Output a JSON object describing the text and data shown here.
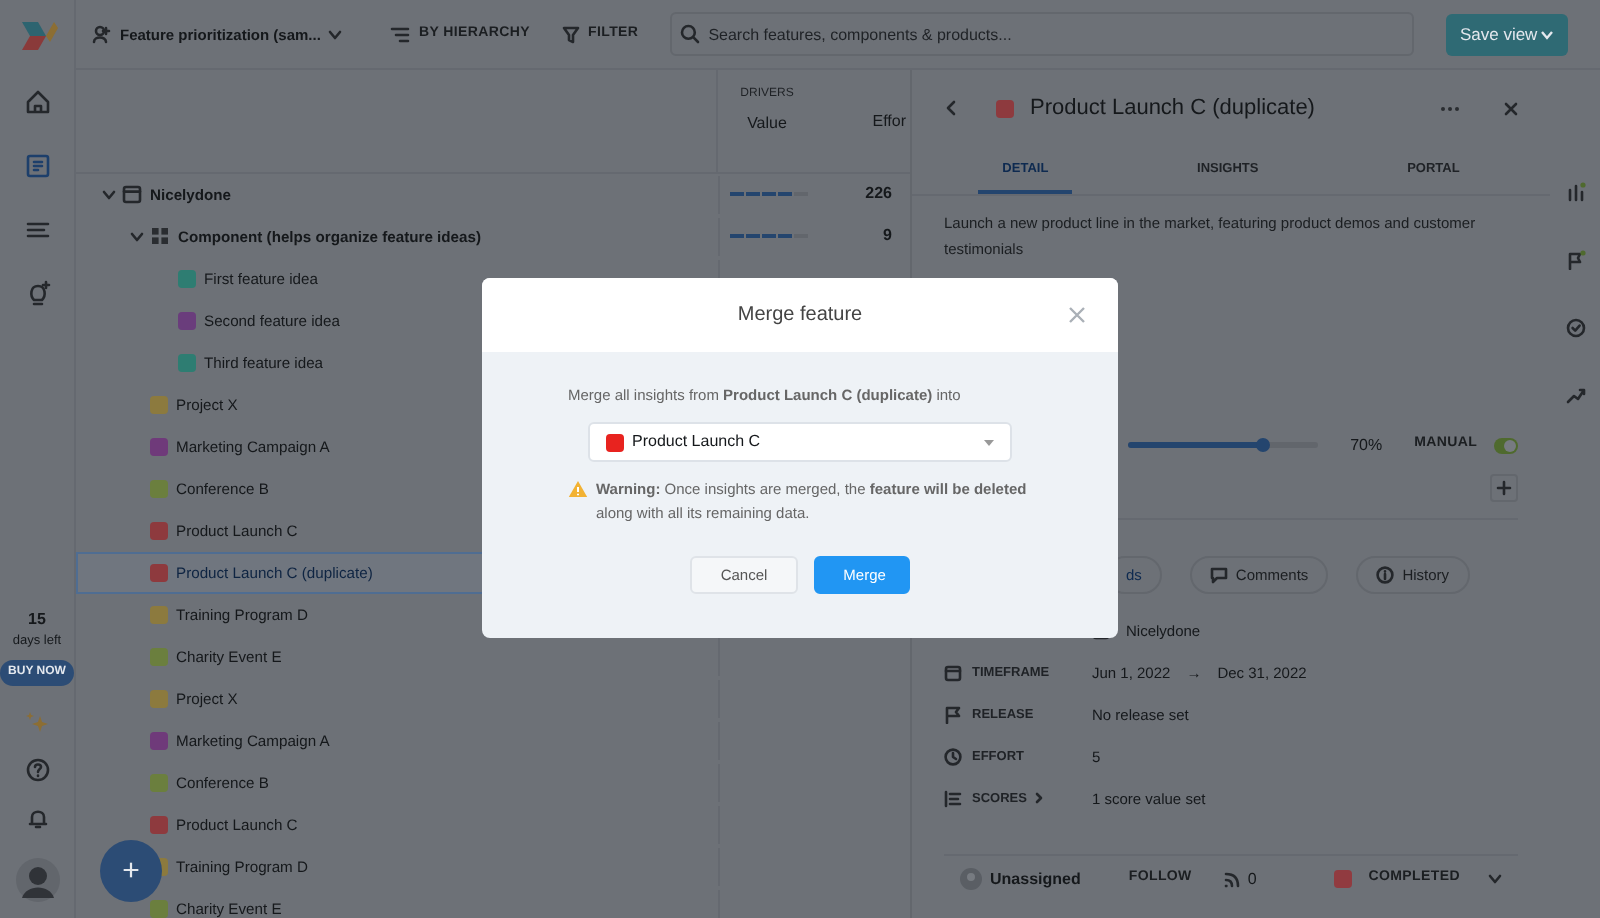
{
  "rail": {
    "items": [
      {
        "kind": "home",
        "selected": false
      },
      {
        "kind": "features",
        "selected": true
      },
      {
        "kind": "roadmap",
        "selected": false
      },
      {
        "kind": "insights",
        "selected": false
      }
    ],
    "trial": {
      "count": "15",
      "label": "days left",
      "button": "BUY NOW"
    }
  },
  "topbar": {
    "view": "Feature prioritization (sam...",
    "group_by": "BY HIERARCHY",
    "filter": "FILTER",
    "search": {
      "placeholder": "Search features, components & products..."
    },
    "save_button": "Save view"
  },
  "table": {
    "group_label": "DRIVERS",
    "columns": [
      "Value",
      "Effor"
    ],
    "rows": [
      {
        "kind": "product",
        "name": "Nicelydone",
        "expanded": true,
        "selected": false,
        "level": 0.8,
        "effort": "226",
        "children": [
          {
            "kind": "component",
            "name": "Component (helps organize feature ideas)",
            "expanded": true,
            "selected": false,
            "level": 0.8,
            "effort": "9",
            "children": [
              {
                "kind": "feature",
                "name": "First feature idea",
                "color": "#2e7d72",
                "selected": false
              },
              {
                "kind": "feature",
                "name": "Second feature idea",
                "color": "#6a3d7c",
                "selected": false
              },
              {
                "kind": "feature",
                "name": "Third feature idea",
                "color": "#2e7d72",
                "selected": false
              }
            ]
          },
          {
            "kind": "feature",
            "name": "Project X",
            "color": "#8c7a3e",
            "selected": false
          },
          {
            "kind": "feature",
            "name": "Marketing Campaign A",
            "color": "#6f3a7a",
            "selected": false
          },
          {
            "kind": "feature",
            "name": "Conference B",
            "color": "#6b7f3e",
            "selected": false
          },
          {
            "kind": "feature",
            "name": "Product Launch C",
            "color": "#8e3a3e",
            "selected": false
          },
          {
            "kind": "feature",
            "name": "Product Launch C (duplicate)",
            "color": "#8e3a3e",
            "selected": true
          },
          {
            "kind": "feature",
            "name": "Training Program D",
            "color": "#8c7a3e",
            "selected": false
          },
          {
            "kind": "feature",
            "name": "Charity Event E",
            "color": "#6b7f3e",
            "selected": false
          },
          {
            "kind": "feature",
            "name": "Project X",
            "color": "#8c7a3e",
            "selected": false
          },
          {
            "kind": "feature",
            "name": "Marketing Campaign A",
            "color": "#6f3a7a",
            "selected": false
          },
          {
            "kind": "feature",
            "name": "Conference B",
            "color": "#6b7f3e",
            "selected": false
          },
          {
            "kind": "feature",
            "name": "Product Launch C",
            "color": "#8e3a3e",
            "selected": false
          },
          {
            "kind": "feature",
            "name": "Training Program D",
            "color": "#8c7a3e",
            "selected": false
          },
          {
            "kind": "feature",
            "name": "Charity Event E",
            "color": "#6b7f3e",
            "selected": false
          }
        ]
      }
    ]
  },
  "add_button": "+",
  "detail": {
    "title": "Product Launch C (duplicate)",
    "color": "#8e3a3e",
    "tabs": [
      {
        "label": "DETAIL",
        "selected": true
      },
      {
        "label": "INSIGHTS",
        "selected": false
      },
      {
        "label": "PORTAL",
        "selected": false
      }
    ],
    "description": "Launch a new product line in the market, featuring product demos and customer testimonials",
    "progress": {
      "level": 0.7,
      "reading": "70%",
      "mode_label": "MANUAL",
      "manual": true
    },
    "subtabs": [
      {
        "kind": "feeds",
        "label": "ds"
      },
      {
        "kind": "comments",
        "label": "Comments"
      },
      {
        "kind": "history",
        "label": "History"
      }
    ],
    "fields": [
      {
        "kind": "product",
        "value": "Nicelydone"
      },
      {
        "kind": "timeframe",
        "label": "TIMEFRAME",
        "start": "Jun 1, 2022",
        "separator": "→",
        "end": "Dec 31, 2022"
      },
      {
        "kind": "release",
        "label": "RELEASE",
        "value": "No release set"
      },
      {
        "kind": "effort",
        "label": "EFFORT",
        "value": "5"
      },
      {
        "kind": "scores",
        "label": "SCORES",
        "value": "1 score value set"
      }
    ],
    "footer": {
      "assignee": "Unassigned",
      "follow": "FOLLOW",
      "followers": "0",
      "status": {
        "label": "COMPLETED",
        "color": "#913b40"
      }
    }
  },
  "modal": {
    "title": "Merge feature",
    "prompt": "Merge all insights from **Product Launch C (duplicate)** into",
    "target": {
      "label": "Product Launch C",
      "color": "#e8231f"
    },
    "warning": "**Warning:** Once insights are merged, the **feature will be deleted** along with all its remaining data.",
    "buttons": [
      {
        "kind": "secondary",
        "label": "Cancel"
      },
      {
        "kind": "primary",
        "label": "Merge"
      }
    ]
  }
}
